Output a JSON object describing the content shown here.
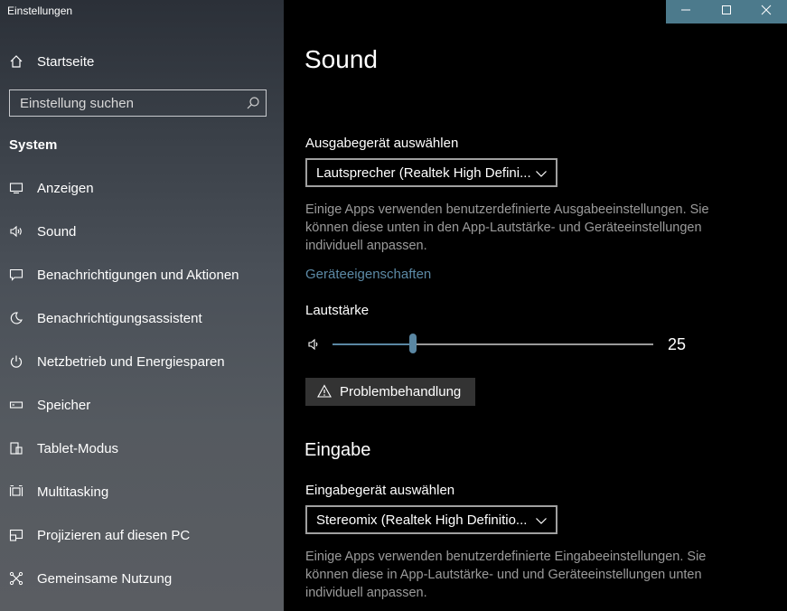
{
  "window": {
    "title": "Einstellungen",
    "accent": "#4c7a8c",
    "buttons": {
      "minimize": "minimize-icon",
      "maximize": "maximize-icon",
      "close": "close-icon"
    }
  },
  "sidebar": {
    "home_label": "Startseite",
    "search_placeholder": "Einstellung suchen",
    "section_title": "System",
    "items": [
      {
        "label": "Anzeigen",
        "icon": "display-icon"
      },
      {
        "label": "Sound",
        "icon": "speaker-icon"
      },
      {
        "label": "Benachrichtigungen und Aktionen",
        "icon": "notification-icon"
      },
      {
        "label": "Benachrichtigungsassistent",
        "icon": "moon-icon"
      },
      {
        "label": "Netzbetrieb und Energiesparen",
        "icon": "power-icon"
      },
      {
        "label": "Speicher",
        "icon": "storage-icon"
      },
      {
        "label": "Tablet-Modus",
        "icon": "tablet-icon"
      },
      {
        "label": "Multitasking",
        "icon": "multitasking-icon"
      },
      {
        "label": "Projizieren auf diesen PC",
        "icon": "project-icon"
      },
      {
        "label": "Gemeinsame Nutzung",
        "icon": "share-icon"
      }
    ]
  },
  "main": {
    "title": "Sound",
    "output": {
      "label": "Ausgabegerät auswählen",
      "device": "Lautsprecher (Realtek High Defini...",
      "description": "Einige Apps verwenden benutzerdefinierte Ausgabeeinstellungen. Sie können diese unten in den App-Lautstärke- und Geräteeinstellungen individuell anpassen.",
      "properties_link": "Geräteeigenschaften",
      "volume_label": "Lautstärke",
      "volume_value": "25",
      "volume_level": 0.25,
      "troubleshoot_label": "Problembehandlung"
    },
    "input": {
      "heading": "Eingabe",
      "label": "Eingabegerät auswählen",
      "device": "Stereomix (Realtek High Definitio...",
      "description": "Einige Apps verwenden benutzerdefinierte Eingabeeinstellungen. Sie können diese in App-Lautstärke- und und Geräteeinstellungen unten individuell anpassen."
    },
    "accent": "#5a87a3"
  }
}
